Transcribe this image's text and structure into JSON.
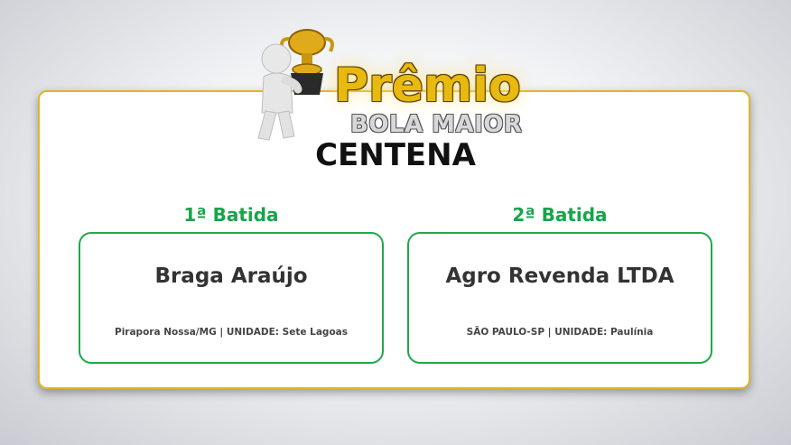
{
  "award": {
    "title_main": "Prêmio",
    "title_sub": "BOLA MAIOR",
    "category": "CENTENA"
  },
  "entries": [
    {
      "label": "1ª Batida",
      "winner": "Braga Araújo",
      "location": "Pirapora Nossa/MG",
      "unit_label": "UNIDADE:",
      "unit": "Sete Lagoas"
    },
    {
      "label": "2ª Batida",
      "winner": "Agro Revenda LTDA",
      "location": "SÃO PAULO-SP",
      "unit_label": "UNIDADE:",
      "unit": "Paulínia"
    }
  ],
  "colors": {
    "accent_gold": "#e1b52a",
    "accent_green": "#1fa84c",
    "text_dark": "#111111"
  }
}
